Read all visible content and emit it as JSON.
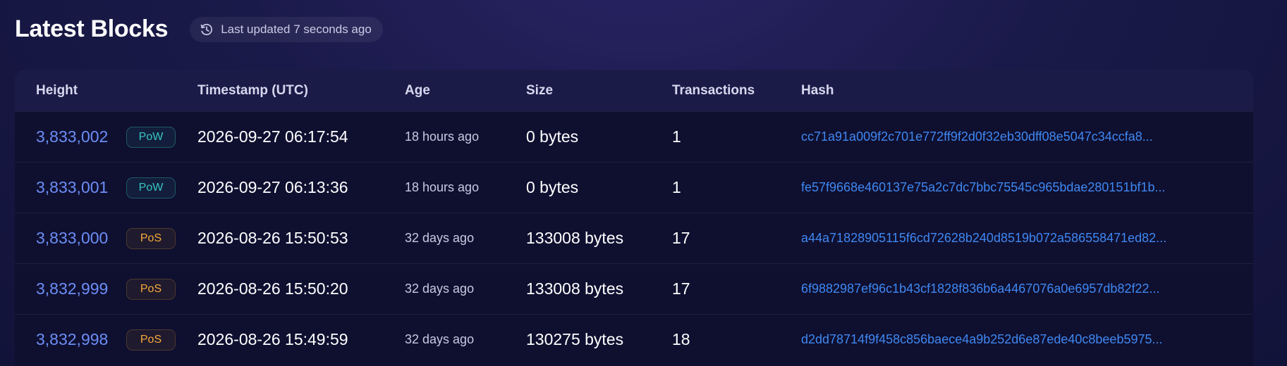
{
  "header": {
    "title": "Latest Blocks",
    "updated_text": "Last updated 7 seconds ago"
  },
  "columns": {
    "height": "Height",
    "timestamp": "Timestamp (UTC)",
    "age": "Age",
    "size": "Size",
    "transactions": "Transactions",
    "hash": "Hash"
  },
  "rows": [
    {
      "height": "3,833,002",
      "type": "PoW",
      "timestamp": "2026-09-27 06:17:54",
      "age": "18 hours ago",
      "size": "0 bytes",
      "transactions": "1",
      "hash": "cc71a91a009f2c701e772ff9f2d0f32eb30dff08e5047c34ccfa8..."
    },
    {
      "height": "3,833,001",
      "type": "PoW",
      "timestamp": "2026-09-27 06:13:36",
      "age": "18 hours ago",
      "size": "0 bytes",
      "transactions": "1",
      "hash": "fe57f9668e460137e75a2c7dc7bbc75545c965bdae280151bf1b..."
    },
    {
      "height": "3,833,000",
      "type": "PoS",
      "timestamp": "2026-08-26 15:50:53",
      "age": "32 days ago",
      "size": "133008 bytes",
      "transactions": "17",
      "hash": "a44a71828905115f6cd72628b240d8519b072a586558471ed82..."
    },
    {
      "height": "3,832,999",
      "type": "PoS",
      "timestamp": "2026-08-26 15:50:20",
      "age": "32 days ago",
      "size": "133008 bytes",
      "transactions": "17",
      "hash": "6f9882987ef96c1b43cf1828f836b6a4467076a0e6957db82f22..."
    },
    {
      "height": "3,832,998",
      "type": "PoS",
      "timestamp": "2026-08-26 15:49:59",
      "age": "32 days ago",
      "size": "130275 bytes",
      "transactions": "18",
      "hash": "d2dd78714f9f458c856baece4a9b252d6e87ede40c8beeb5975..."
    }
  ],
  "colors": {
    "link": "#6c8ef5",
    "hash": "#3f88f0",
    "pow": "#37c5c2",
    "pos": "#f3a93b"
  },
  "icons": {
    "updated": "clock-history-icon"
  }
}
